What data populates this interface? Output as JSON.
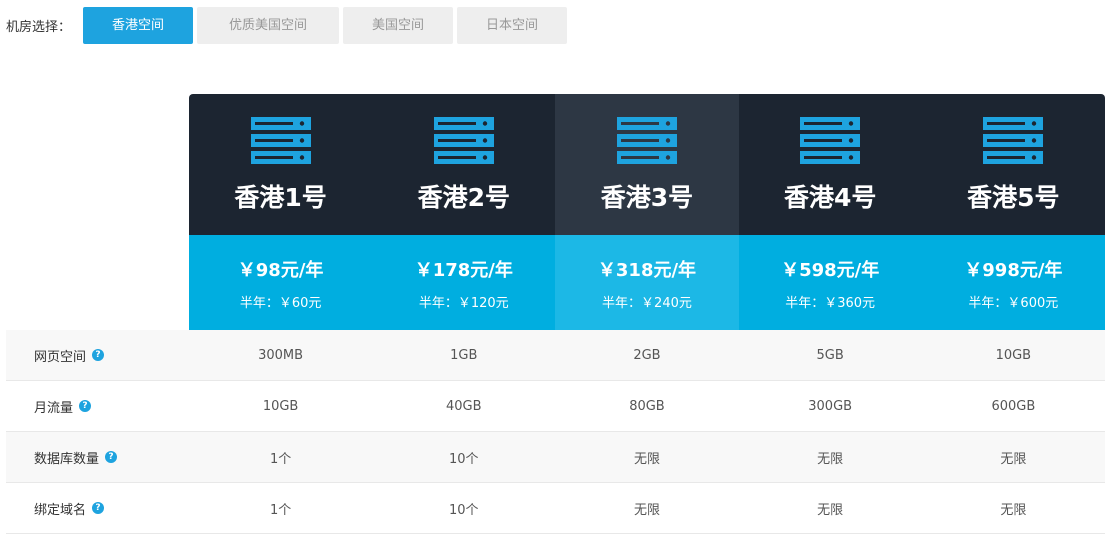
{
  "filter": {
    "label": "机房选择：",
    "tabs": [
      {
        "label": "香港空间",
        "active": true
      },
      {
        "label": "优质美国空间",
        "active": false
      },
      {
        "label": "美国空间",
        "active": false
      },
      {
        "label": "日本空间",
        "active": false
      }
    ]
  },
  "colors": {
    "accent": "#1ea3df",
    "plan_header_dark": "#1c2531",
    "plan_header_highlight": "#2d3744",
    "price_bg": "#00aee0",
    "icon": "#1ea3df"
  },
  "plans": [
    {
      "name": "香港1号",
      "price_year": "￥98元/年",
      "price_half": "半年：￥60元",
      "icon": "server-icon"
    },
    {
      "name": "香港2号",
      "price_year": "￥178元/年",
      "price_half": "半年：￥120元",
      "icon": "server-icon"
    },
    {
      "name": "香港3号",
      "price_year": "￥318元/年",
      "price_half": "半年：￥240元",
      "icon": "server-icon",
      "highlight": true
    },
    {
      "name": "香港4号",
      "price_year": "￥598元/年",
      "price_half": "半年：￥360元",
      "icon": "server-icon"
    },
    {
      "name": "香港5号",
      "price_year": "￥998元/年",
      "price_half": "半年：￥600元",
      "icon": "server-icon"
    }
  ],
  "features": [
    {
      "name": "网页空间",
      "values": [
        "300MB",
        "1GB",
        "2GB",
        "5GB",
        "10GB"
      ]
    },
    {
      "name": "月流量",
      "values": [
        "10GB",
        "40GB",
        "80GB",
        "300GB",
        "600GB"
      ]
    },
    {
      "name": "数据库数量",
      "values": [
        "1个",
        "10个",
        "无限",
        "无限",
        "无限"
      ]
    },
    {
      "name": "绑定域名",
      "values": [
        "1个",
        "10个",
        "无限",
        "无限",
        "无限"
      ]
    }
  ],
  "help_icon_glyph": "?"
}
